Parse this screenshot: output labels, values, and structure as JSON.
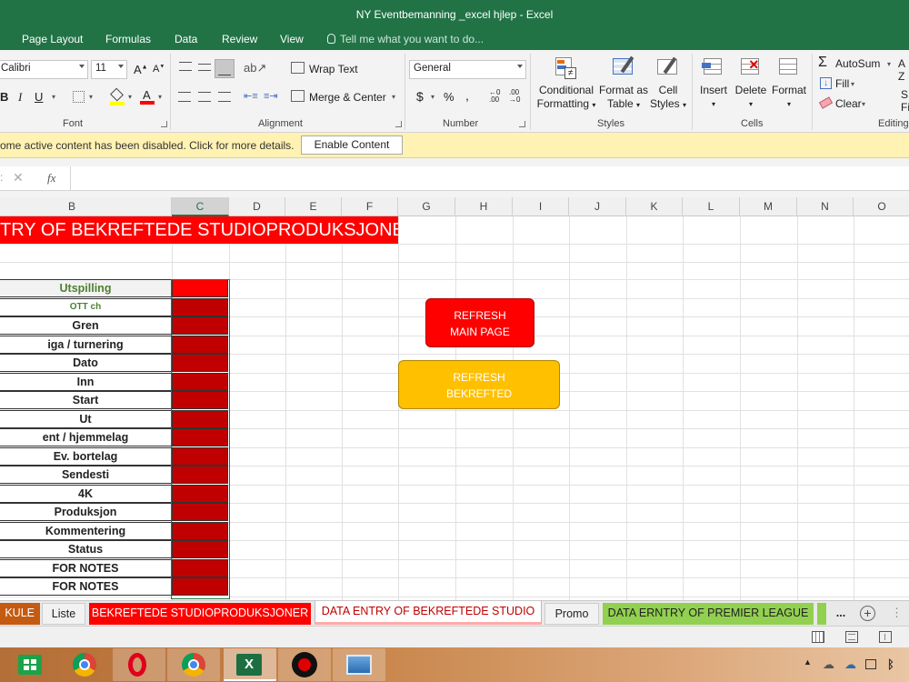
{
  "window": {
    "title": "NY Eventbemanning _excel hjlep - Excel"
  },
  "ribbon_tabs": [
    "Page Layout",
    "Formulas",
    "Data",
    "Review",
    "View"
  ],
  "tell_me": "Tell me what you want to do...",
  "ribbon": {
    "font_name": "Calibri",
    "font_size": "11",
    "wrap_text": "Wrap Text",
    "merge_center": "Merge & Center",
    "number_format": "General",
    "conditional": [
      "Conditional",
      "Formatting"
    ],
    "format_as": [
      "Format as",
      "Table"
    ],
    "cell_styles": [
      "Cell",
      "Styles"
    ],
    "insert": "Insert",
    "delete": "Delete",
    "format": "Format",
    "autosum": "AutoSum",
    "fill": "Fill",
    "clear": "Clear",
    "groups": {
      "font": "Font",
      "alignment": "Alignment",
      "number": "Number",
      "styles": "Styles",
      "cells": "Cells",
      "editing": "Editing"
    }
  },
  "message_bar": {
    "text": "ome active content has been disabled. Click for more details.",
    "button": "Enable Content"
  },
  "formula_bar": {
    "fx": "fx"
  },
  "columns": [
    "B",
    "C",
    "D",
    "E",
    "F",
    "G",
    "H",
    "I",
    "J",
    "K",
    "L",
    "M",
    "N",
    "O"
  ],
  "selected_column": "C",
  "sheet": {
    "banner": "TRY OF BEKREFTEDE STUDIOPRODUKSJONER",
    "labels": [
      "Utspilling",
      "OTT ch",
      "Gren",
      "iga / turnering",
      "Dato",
      "Inn",
      "Start",
      "Ut",
      "ent / hjemmelag",
      "Ev. bortelag",
      "Sendesti",
      "4K",
      "Produksjon",
      "Kommentering",
      "Status",
      "FOR NOTES",
      "FOR NOTES"
    ],
    "refresh_main": [
      "REFRESH",
      "MAIN PAGE"
    ],
    "refresh_bekreftet": [
      "REFRESH",
      "BEKREFTED"
    ]
  },
  "sheet_tabs": [
    {
      "label": "KULE",
      "bg": "#c55a11",
      "color": "#ffffff"
    },
    {
      "label": "Liste",
      "bg": "#f2f2f2",
      "color": "#222222"
    },
    {
      "label": "BEKREFTEDE STUDIOPRODUKSJONER",
      "bg": "#ff0000",
      "color": "#ffffff"
    },
    {
      "label": "DATA ENTRY OF BEKREFTEDE STUDIO",
      "bg": "#ffffff",
      "color": "#c00000"
    },
    {
      "label": "Promo",
      "bg": "#f2f2f2",
      "color": "#222222"
    },
    {
      "label": "DATA ERNTRY OF PREMIER LEAGUE",
      "bg": "#92d050",
      "color": "#222222"
    }
  ],
  "sheet_more": "...",
  "colors": {
    "excel_green": "#217346",
    "cell_red": "#c00000",
    "banner_red": "#ff0000",
    "button_yellow": "#ffc000"
  },
  "taskbar_apps": [
    "store-icon",
    "chrome-icon",
    "opera-icon",
    "chrome-alt-icon",
    "excel-icon",
    "recorder-icon",
    "photos-icon"
  ]
}
